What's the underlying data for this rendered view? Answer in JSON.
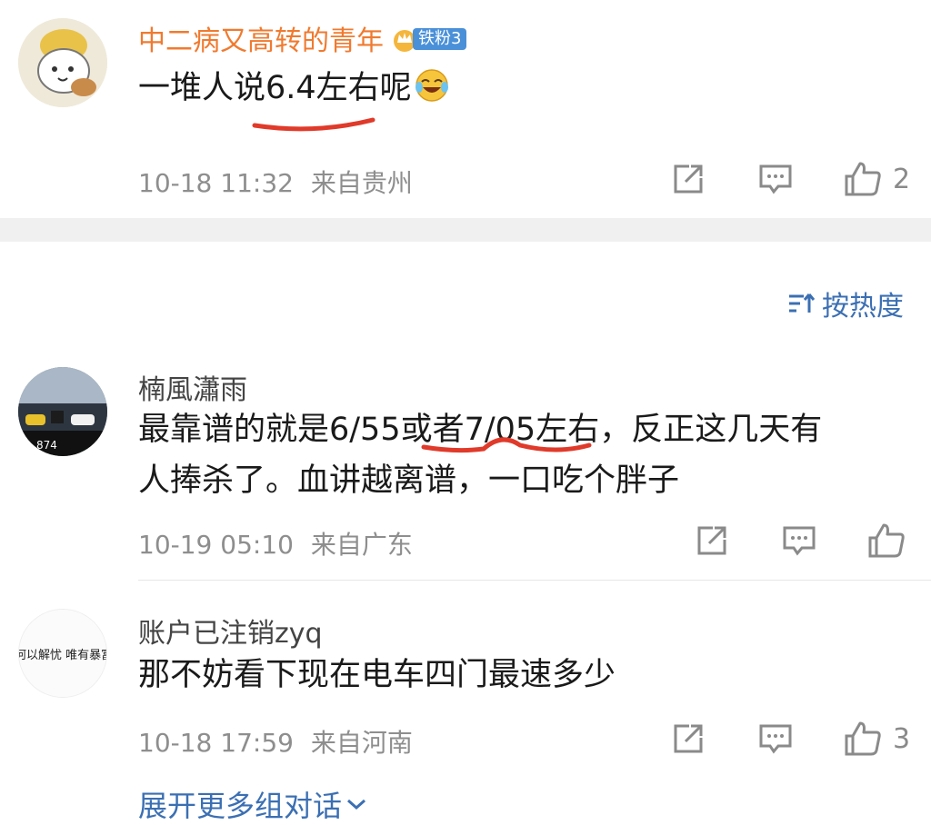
{
  "comments": [
    {
      "username": "中二病又高转的青年",
      "badge": "铁粉3",
      "text": "一堆人说6.4左右呢",
      "emoji": "laughing-crying-emoji",
      "time": "10-18 11:32",
      "location": "来自贵州",
      "likes": "2"
    },
    {
      "username": "楠風瀟雨",
      "text_line1": "最靠谱的就是6/55或者7/05左右，反正这几天有",
      "text_line2": "人捧杀了。血讲越离谱，一口吃个胖子",
      "time": "10-19 05:10",
      "location": "来自广东",
      "likes": ""
    },
    {
      "username": "账户已注销zyq",
      "text": "那不妨看下现在电车四门最速多少",
      "time": "10-18 17:59",
      "location": "来自河南",
      "likes": "3"
    }
  ],
  "sort_label": "按热度",
  "expand_label": "展开更多组对话",
  "avatar2_caption": "874",
  "avatar3_text": "何以解忧 唯有暴富",
  "colors": {
    "username_highlight": "#f07a2f",
    "link_blue": "#3b6fb3",
    "badge_blue": "#4a90d9",
    "annotation_red": "#e03a2a"
  }
}
